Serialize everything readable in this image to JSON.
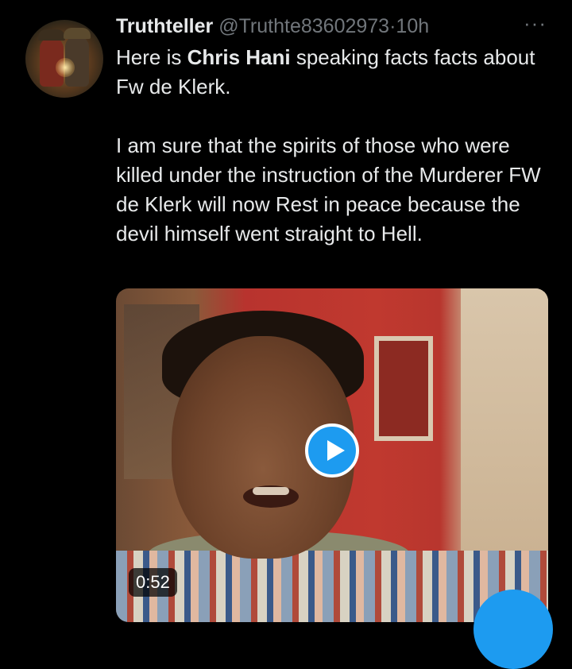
{
  "tweet": {
    "author_name": "Truthteller",
    "handle": "@Truthte83602973",
    "separator": "·",
    "time": "10h",
    "more_icon": "···",
    "text_line1_prefix": "Here is ",
    "text_line1_bold": "Chris Hani",
    "text_line1_suffix": " speaking facts  facts about Fw de Klerk.",
    "text_paragraph2": "I am sure that the spirits of those who were killed under the instruction of the Murderer FW de Klerk will now Rest in peace because the devil himself went straight to Hell."
  },
  "media": {
    "type": "video",
    "duration": "0:52",
    "play_icon": "play-icon"
  },
  "colors": {
    "background": "#000000",
    "text": "#e7e9ea",
    "secondary": "#71767b",
    "accent": "#1d9bf0"
  },
  "compose_button": {
    "icon": "compose-icon"
  }
}
